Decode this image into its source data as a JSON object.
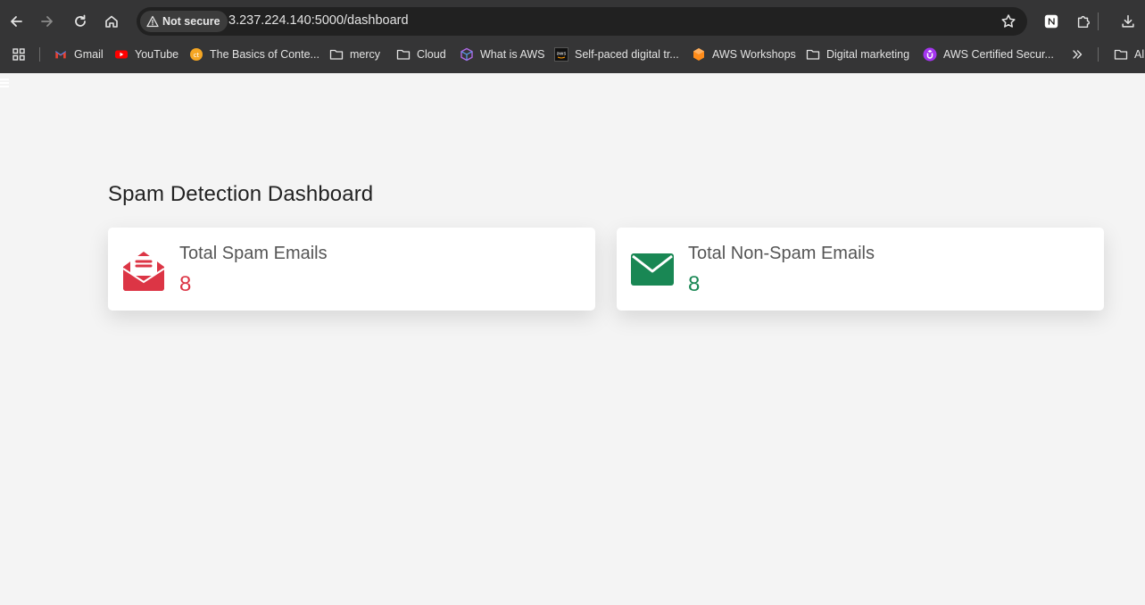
{
  "browser": {
    "security_label": "Not secure",
    "url": "3.237.224.140:5000/dashboard",
    "bookmarks": [
      {
        "label": "Gmail",
        "icon": "gmail-icon"
      },
      {
        "label": "YouTube",
        "icon": "youtube-icon"
      },
      {
        "label": "The Basics of Conte...",
        "icon": "site-favicon-icon"
      },
      {
        "label": "mercy",
        "icon": "folder-icon"
      },
      {
        "label": "Cloud",
        "icon": "folder-icon"
      },
      {
        "label": "What is AWS",
        "icon": "cube-icon"
      },
      {
        "label": "Self-paced digital tr...",
        "icon": "aws-icon"
      },
      {
        "label": "AWS Workshops",
        "icon": "hexagon-icon"
      },
      {
        "label": "Digital marketing",
        "icon": "folder-icon"
      },
      {
        "label": "AWS Certified Secur...",
        "icon": "udemy-icon"
      },
      {
        "label": "Al",
        "icon": "folder-icon"
      }
    ]
  },
  "dashboard": {
    "title": "Spam Detection Dashboard",
    "cards": [
      {
        "label": "Total Spam Emails",
        "value": "8",
        "color": "#dc3545",
        "icon": "envelope-open-text-icon"
      },
      {
        "label": "Total Non-Spam Emails",
        "value": "8",
        "color": "#198754",
        "icon": "envelope-icon"
      }
    ]
  }
}
